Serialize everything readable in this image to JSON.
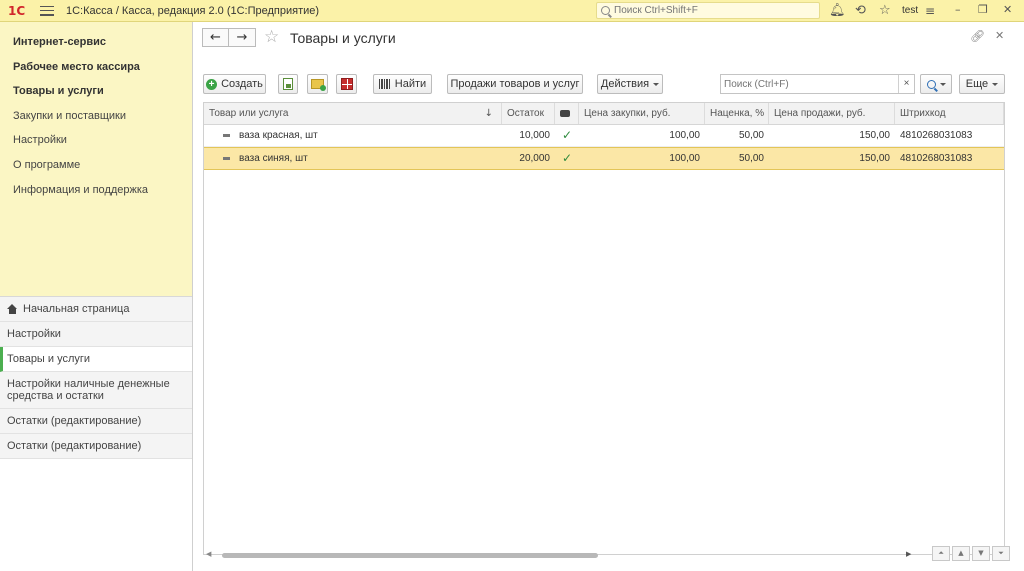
{
  "titlebar": {
    "app_title": "1С:Касса / Касса, редакция 2.0  (1С:Предприятие)",
    "search_placeholder": "Поиск Ctrl+Shift+F",
    "user": "test"
  },
  "sidebar": {
    "sections": [
      {
        "label": "Интернет-сервис",
        "bold": true
      },
      {
        "label": "Рабочее место кассира",
        "bold": true
      },
      {
        "label": "Товары и услуги",
        "bold": true
      },
      {
        "label": "Закупки и поставщики",
        "bold": false
      },
      {
        "label": "Настройки",
        "bold": false
      },
      {
        "label": "О программе",
        "bold": false
      },
      {
        "label": "Информация и поддержка",
        "bold": false
      }
    ],
    "open_windows": [
      {
        "label": "Начальная страница"
      },
      {
        "label": "Настройки"
      },
      {
        "label": "Товары и услуги"
      },
      {
        "label": "Настройки наличные денежные средства и остатки"
      },
      {
        "label": "Остатки (редактирование)"
      },
      {
        "label": "Остатки (редактирование)"
      }
    ]
  },
  "main": {
    "title": "Товары и услуги",
    "toolbar": {
      "create_label": "Создать",
      "find_label": "Найти",
      "sales_label": "Продажи товаров и услуг",
      "actions_label": "Действия",
      "search_placeholder": "Поиск (Ctrl+F)",
      "clear_label": "×",
      "more_label": "Еще"
    },
    "table": {
      "columns": [
        "Товар или услуга",
        "Остаток",
        "",
        "Цена закупки, руб.",
        "Наценка, %",
        "Цена продажи, руб.",
        "Штрихкод"
      ],
      "sort_indicator": "↓",
      "rows": [
        {
          "name": "ваза красная, шт",
          "stock": "10,000",
          "check": "✓",
          "purchase": "100,00",
          "markup": "50,00",
          "sale": "150,00",
          "barcode": "4810268031083",
          "selected": false
        },
        {
          "name": "ваза синяя, шт",
          "stock": "20,000",
          "check": "✓",
          "purchase": "100,00",
          "markup": "50,00",
          "sale": "150,00",
          "barcode": "4810268031083",
          "selected": true
        }
      ]
    }
  },
  "colors": {
    "titlebar_bg": "#fbf2a8",
    "sidebar_bg": "#fbf6c4",
    "selected_row": "#fbe7a6",
    "accent_green": "#3aa346"
  }
}
